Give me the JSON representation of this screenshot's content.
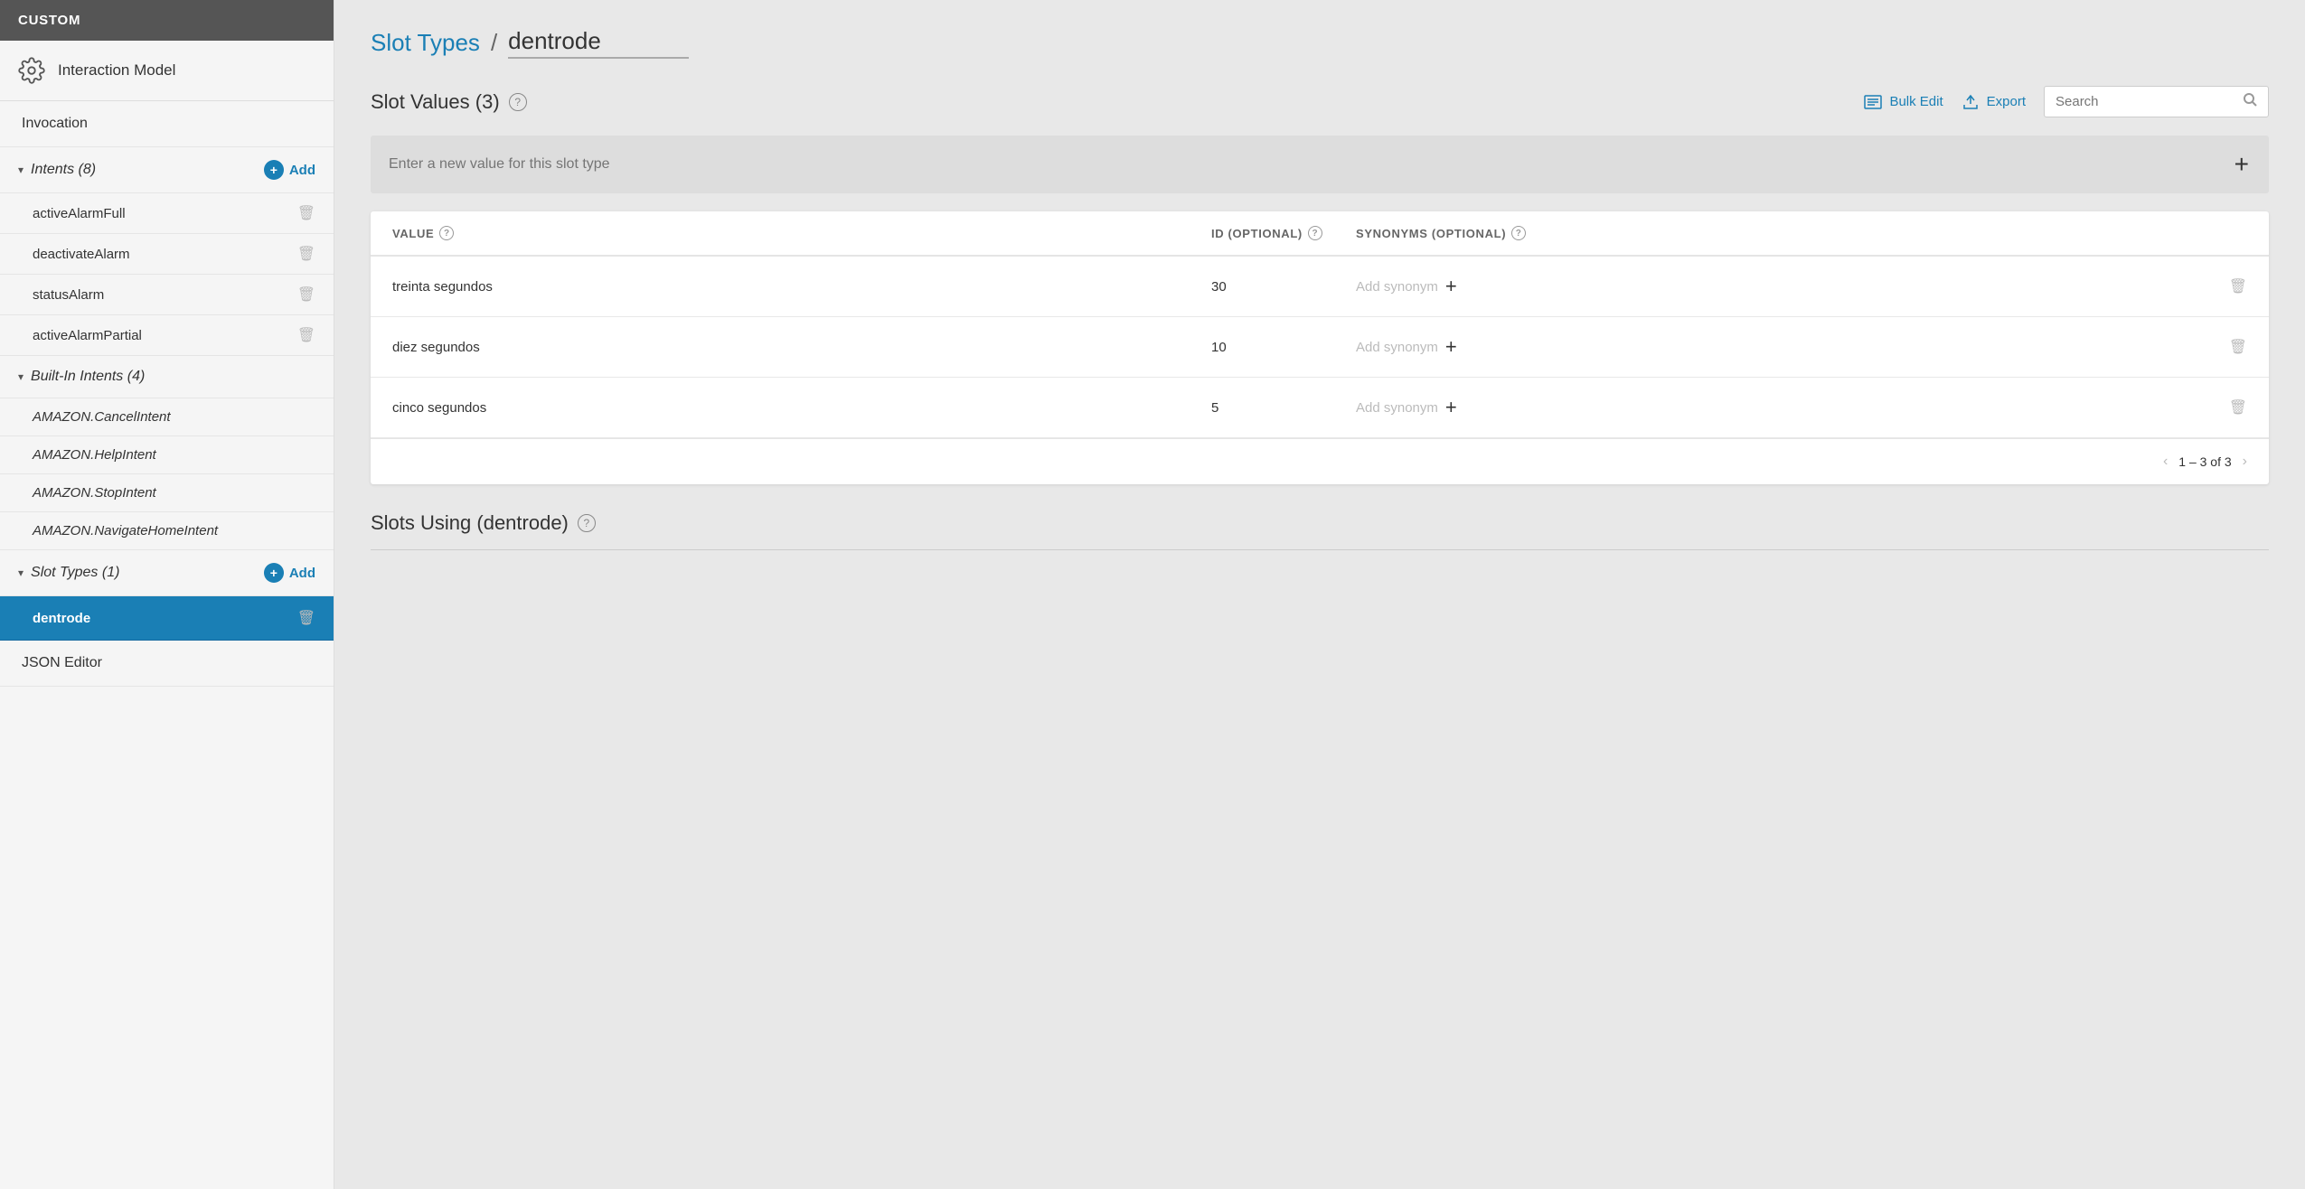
{
  "sidebar": {
    "header": "CUSTOM",
    "interaction_model_label": "Interaction Model",
    "invocation_label": "Invocation",
    "intents_group": {
      "label": "Intents (8)",
      "add_label": "Add",
      "items": [
        {
          "name": "activeAlarmFull"
        },
        {
          "name": "deactivateAlarm"
        },
        {
          "name": "statusAlarm"
        },
        {
          "name": "activeAlarmPartial"
        }
      ]
    },
    "builtin_intents_group": {
      "label": "Built-In Intents (4)",
      "items": [
        {
          "name": "AMAZON.CancelIntent"
        },
        {
          "name": "AMAZON.HelpIntent"
        },
        {
          "name": "AMAZON.StopIntent"
        },
        {
          "name": "AMAZON.NavigateHomeIntent"
        }
      ]
    },
    "slot_types_group": {
      "label": "Slot Types (1)",
      "add_label": "Add",
      "items": [
        {
          "name": "dentrode",
          "active": true
        }
      ]
    },
    "json_editor_label": "JSON Editor"
  },
  "main": {
    "breadcrumb_link": "Slot Types",
    "breadcrumb_separator": "/",
    "breadcrumb_current": "dentrode",
    "slot_values_title": "Slot Values (3)",
    "bulk_edit_label": "Bulk Edit",
    "export_label": "Export",
    "search_placeholder": "Search",
    "new_value_placeholder": "Enter a new value for this slot type",
    "table": {
      "headers": {
        "value": "VALUE",
        "id": "ID (OPTIONAL)",
        "synonyms": "SYNONYMS (OPTIONAL)"
      },
      "rows": [
        {
          "value": "treinta segundos",
          "id": "30",
          "synonym_placeholder": "Add synonym"
        },
        {
          "value": "diez segundos",
          "id": "10",
          "synonym_placeholder": "Add synonym"
        },
        {
          "value": "cinco segundos",
          "id": "5",
          "synonym_placeholder": "Add synonym"
        }
      ],
      "pagination": "1 – 3 of 3"
    },
    "slots_using_title": "Slots Using (dentrode)"
  }
}
